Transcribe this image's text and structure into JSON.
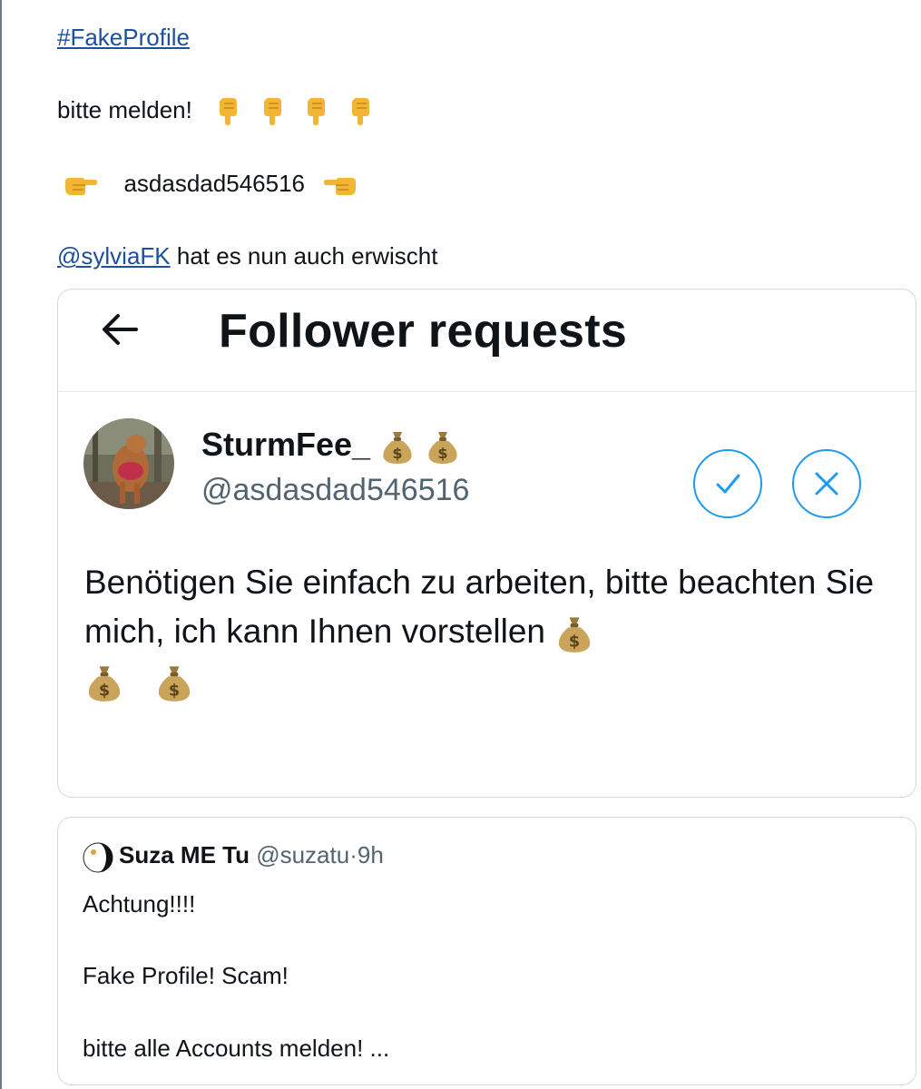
{
  "post": {
    "hashtag": "#FakeProfile",
    "line2_text": "bitte melden!",
    "line3_handle": "asdasdad546516",
    "mention": "@sylviaFK",
    "line4_rest": " hat es nun auch erwischt"
  },
  "screenshot": {
    "title": "Follower requests",
    "request": {
      "display_name": "SturmFee_",
      "handle": "@asdasdad546516",
      "bio": "Benötigen Sie einfach zu arbeiten, bitte beachten Sie mich, ich kann Ihnen vorstellen"
    }
  },
  "quote": {
    "name": "Suza ME Tu",
    "handle": "@suzatu",
    "separator": "·",
    "time": "9h",
    "line1": "Achtung!!!!",
    "line2": "Fake Profile! Scam!",
    "line3": "bitte alle Accounts melden! ..."
  },
  "icons": {
    "pointing_down": "pointing-down-emoji",
    "pointing_right": "pointing-right-emoji",
    "pointing_left": "pointing-left-emoji",
    "money_bag": "money-bag-emoji",
    "back": "back-arrow-icon",
    "accept": "checkmark-icon",
    "decline": "close-icon"
  },
  "colors": {
    "link": "#1d4f9e",
    "accent": "#1d9bf0",
    "muted": "#536471"
  }
}
